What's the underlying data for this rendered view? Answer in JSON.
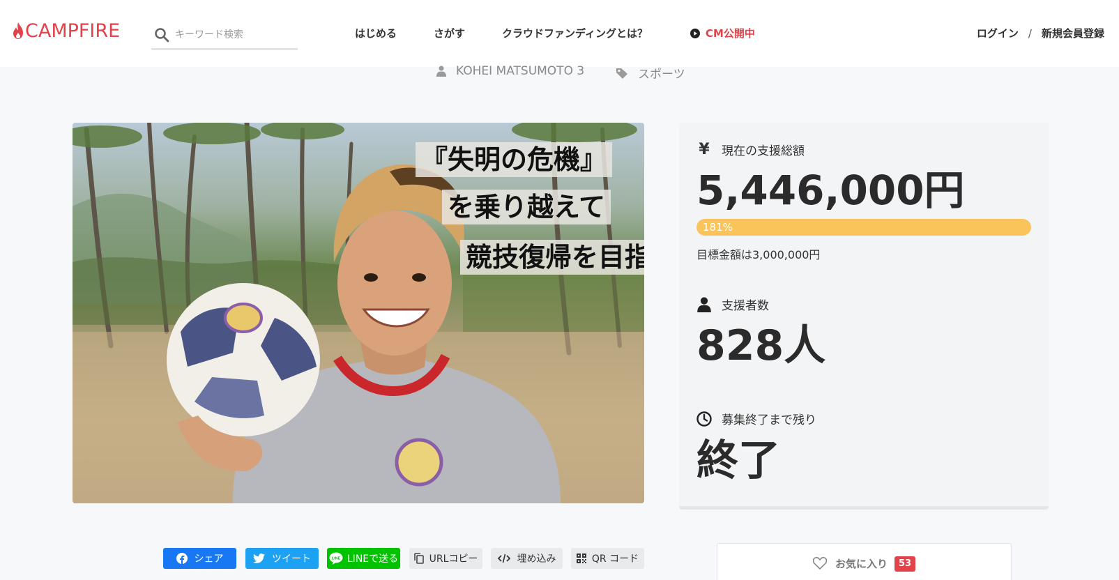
{
  "brand": {
    "name": "CAMPFIRE",
    "accent": "#e2424a"
  },
  "search": {
    "placeholder": "キーワード検索"
  },
  "nav": {
    "start": "はじめる",
    "explore": "さがす",
    "about": "クラウドファンディングとは？",
    "cm": "CM公開中"
  },
  "auth": {
    "login": "ログイン",
    "separator": "/",
    "signup": "新規会員登録"
  },
  "project_meta": {
    "owner": "KOHEI MATSUMOTO 3",
    "category": "スポーツ"
  },
  "hero": {
    "caption_lines": [
      "『失明の危機』",
      "を乗り越えて",
      "競技復帰を目指す"
    ]
  },
  "stats": {
    "raised_label": "現在の支援総額",
    "raised_icon_glyph": "¥",
    "raised_amount": "5,446,000円",
    "progress_label": "181%",
    "progress_percent": 181,
    "progress_color": "#fac45a",
    "goal_text": "目標金額は3,000,000円",
    "backers_label": "支援者数",
    "backers_value": "828人",
    "remaining_label": "募集終了まで残り",
    "remaining_value": "終了"
  },
  "share": {
    "facebook": "シェア",
    "twitter": "ツイート",
    "line": "LINEで送る",
    "url_copy": "URLコピー",
    "embed": "埋め込み",
    "qr": "QR コード"
  },
  "favorite": {
    "label": "お気に入り",
    "count": "53"
  },
  "icons": [
    "flame-icon",
    "search-icon",
    "play-icon",
    "user-icon",
    "tag-icon",
    "yen-icon",
    "person-icon",
    "clock-icon",
    "facebook-icon",
    "twitter-icon",
    "line-icon",
    "copy-icon",
    "code-icon",
    "qr-icon",
    "heart-icon"
  ]
}
